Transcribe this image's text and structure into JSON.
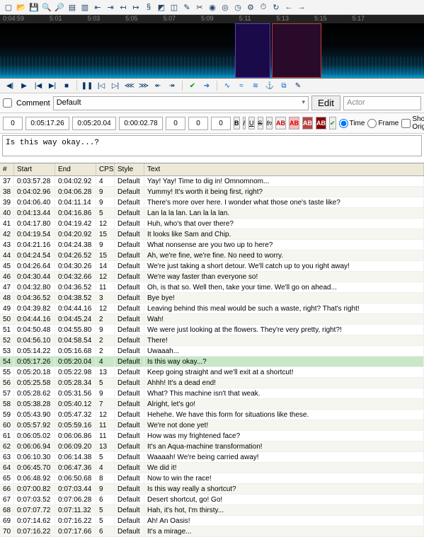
{
  "toolbar_icons": [
    "new",
    "open",
    "save",
    "search-plus",
    "search-minus",
    "doc1",
    "doc2",
    "jump-start",
    "jump-end",
    "shift-left",
    "shift-right",
    "bold-s",
    "tag",
    "link",
    "clip",
    "scissors",
    "circle-dot",
    "target",
    "clock",
    "gear",
    "timer",
    "refresh",
    "arrow-left",
    "arrow-right"
  ],
  "timeruler": [
    "0:04:59",
    "5:01",
    "5:03",
    "5:05",
    "5:07",
    "5:09",
    "5:11",
    "5:13",
    "5:15",
    "5:17"
  ],
  "play_icons": [
    "prev-end",
    "play",
    "goto-start",
    "goto-end",
    "stop",
    "pause",
    "step-back",
    "step-fwd",
    "skip-back",
    "skip-fwd",
    "lead-in",
    "lead-out",
    "check-green",
    "arrow-blue",
    "wave-a",
    "wave-b",
    "wave-c",
    "anchor",
    "link",
    "pencil"
  ],
  "editrow": {
    "comment_label": "Comment",
    "style": "Default",
    "edit_btn": "Edit",
    "actor_placeholder": "Actor"
  },
  "timerow": {
    "layer": "0",
    "start": "0:05:17.26",
    "end": "0:05:20.04",
    "dur": "0:00:02.78",
    "m1": "0",
    "m2": "0",
    "m3": "0",
    "fmt_b": "B",
    "fmt_i": "I",
    "fmt_u": "U",
    "fmt_s": "S",
    "fmt_fn": "fn",
    "fmt_ab1": "AB",
    "fmt_ab2": "AB",
    "fmt_ab3": "AB",
    "fmt_ab4": "AB",
    "opt_time": "Time",
    "opt_frame": "Frame",
    "opt_show": "Show Original"
  },
  "textarea_value": "Is this way okay...?",
  "grid_headers": {
    "n": "#",
    "start": "Start",
    "end": "End",
    "cps": "CPS",
    "style": "Style",
    "text": "Text"
  },
  "rows": [
    {
      "n": 37,
      "s": "0:03:57.28",
      "e": "0:04:02.92",
      "c": 4,
      "st": "Default",
      "t": "Yay! Yay! Time to dig in! Omnomnom..."
    },
    {
      "n": 38,
      "s": "0:04:02.96",
      "e": "0:04:06.28",
      "c": 9,
      "st": "Default",
      "t": "Yummy! It's worth it being first, right?"
    },
    {
      "n": 39,
      "s": "0:04:06.40",
      "e": "0:04:11.14",
      "c": 9,
      "st": "Default",
      "t": "There's more over here. I wonder what those one's taste like?"
    },
    {
      "n": 40,
      "s": "0:04:13.44",
      "e": "0:04:16.86",
      "c": 5,
      "st": "Default",
      "t": "Lan la la lan. Lan la la lan."
    },
    {
      "n": 41,
      "s": "0:04:17.80",
      "e": "0:04:19.42",
      "c": 12,
      "st": "Default",
      "t": "Huh, who's that over there?"
    },
    {
      "n": 42,
      "s": "0:04:19.54",
      "e": "0:04:20.92",
      "c": 15,
      "st": "Default",
      "t": "It looks like Sam and Chip."
    },
    {
      "n": 43,
      "s": "0:04:21.16",
      "e": "0:04:24.38",
      "c": 9,
      "st": "Default",
      "t": "What nonsense are you two up to here?"
    },
    {
      "n": 44,
      "s": "0:04:24.54",
      "e": "0:04:26.52",
      "c": 15,
      "st": "Default",
      "t": "Ah, we're fine, we're fine. No need to worry."
    },
    {
      "n": 45,
      "s": "0:04:26.64",
      "e": "0:04:30.26",
      "c": 14,
      "st": "Default",
      "t": "We're just taking a short detour. We'll catch up to you right away!"
    },
    {
      "n": 46,
      "s": "0:04:30.44",
      "e": "0:04:32.66",
      "c": 12,
      "st": "Default",
      "t": "We're way faster than everyone so!"
    },
    {
      "n": 47,
      "s": "0:04:32.80",
      "e": "0:04:36.52",
      "c": 11,
      "st": "Default",
      "t": "Oh, is that so. Well then, take your time. We'll go on ahead..."
    },
    {
      "n": 48,
      "s": "0:04:36.52",
      "e": "0:04:38.52",
      "c": 3,
      "st": "Default",
      "t": "Bye bye!"
    },
    {
      "n": 49,
      "s": "0:04:39.82",
      "e": "0:04:44.16",
      "c": 12,
      "st": "Default",
      "t": "Leaving behind this meal would be such a waste, right? That's right!"
    },
    {
      "n": 50,
      "s": "0:04:44.16",
      "e": "0:04:45.24",
      "c": 2,
      "st": "Default",
      "t": "Wah!"
    },
    {
      "n": 51,
      "s": "0:04:50.48",
      "e": "0:04:55.80",
      "c": 9,
      "st": "Default",
      "t": "We were just looking at the flowers. They're very pretty, right?!"
    },
    {
      "n": 52,
      "s": "0:04:56.10",
      "e": "0:04:58.54",
      "c": 2,
      "st": "Default",
      "t": "There!"
    },
    {
      "n": 53,
      "s": "0:05:14.22",
      "e": "0:05:16.68",
      "c": 2,
      "st": "Default",
      "t": "Uwaaah..."
    },
    {
      "n": 54,
      "s": "0:05:17.26",
      "e": "0:05:20.04",
      "c": 4,
      "st": "Default",
      "t": "Is this way okay...?",
      "sel": true
    },
    {
      "n": 55,
      "s": "0:05:20.18",
      "e": "0:05:22.98",
      "c": 13,
      "st": "Default",
      "t": "Keep going straight and we'll exit at a shortcut!"
    },
    {
      "n": 56,
      "s": "0:05:25.58",
      "e": "0:05:28.34",
      "c": 5,
      "st": "Default",
      "t": "Ahhh! It's a dead end!"
    },
    {
      "n": 57,
      "s": "0:05:28.62",
      "e": "0:05:31.56",
      "c": 9,
      "st": "Default",
      "t": "What? This machine isn't that weak."
    },
    {
      "n": 58,
      "s": "0:05:38.28",
      "e": "0:05:40.12",
      "c": 7,
      "st": "Default",
      "t": "Alright, let's go!"
    },
    {
      "n": 59,
      "s": "0:05:43.90",
      "e": "0:05:47.32",
      "c": 12,
      "st": "Default",
      "t": "Hehehe. We have this form for situations like these."
    },
    {
      "n": 60,
      "s": "0:05:57.92",
      "e": "0:05:59.16",
      "c": 11,
      "st": "Default",
      "t": "We're not done yet!"
    },
    {
      "n": 61,
      "s": "0:06:05.02",
      "e": "0:06:06.86",
      "c": 11,
      "st": "Default",
      "t": "How was my frightened face?"
    },
    {
      "n": 62,
      "s": "0:06:06.94",
      "e": "0:06:09.20",
      "c": 13,
      "st": "Default",
      "t": "It's an Aqua-machine transformation!"
    },
    {
      "n": 63,
      "s": "0:06:10.30",
      "e": "0:06:14.38",
      "c": 5,
      "st": "Default",
      "t": "Waaaah! We're being carried away!"
    },
    {
      "n": 64,
      "s": "0:06:45.70",
      "e": "0:06:47.36",
      "c": 4,
      "st": "Default",
      "t": "We did it!"
    },
    {
      "n": 65,
      "s": "0:06:48.92",
      "e": "0:06:50.68",
      "c": 8,
      "st": "Default",
      "t": "Now to win the race!"
    },
    {
      "n": 66,
      "s": "0:07:00.82",
      "e": "0:07:03.44",
      "c": 9,
      "st": "Default",
      "t": "Is this way really a shortcut?"
    },
    {
      "n": 67,
      "s": "0:07:03.52",
      "e": "0:07:06.28",
      "c": 6,
      "st": "Default",
      "t": "Desert shortcut, go! Go!"
    },
    {
      "n": 68,
      "s": "0:07:07.72",
      "e": "0:07:11.32",
      "c": 5,
      "st": "Default",
      "t": "Hah, it's hot, I'm thirsty..."
    },
    {
      "n": 69,
      "s": "0:07:14.62",
      "e": "0:07:16.22",
      "c": 5,
      "st": "Default",
      "t": "Ah! An Oasis!"
    },
    {
      "n": 70,
      "s": "0:07:16.22",
      "e": "0:07:17.66",
      "c": 6,
      "st": "Default",
      "t": "It's a mirage..."
    }
  ]
}
